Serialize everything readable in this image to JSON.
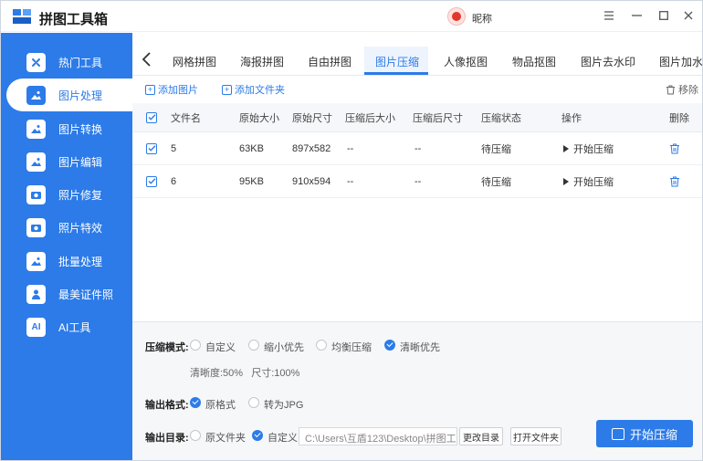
{
  "app": {
    "title": "拼图工具箱",
    "nickname": "昵称"
  },
  "sidebar": {
    "items": [
      {
        "label": "热门工具",
        "icon": "hot-tools-icon"
      },
      {
        "label": "图片处理",
        "icon": "image-process-icon",
        "active": true
      },
      {
        "label": "图片转换",
        "icon": "image-convert-icon"
      },
      {
        "label": "图片编辑",
        "icon": "image-edit-icon"
      },
      {
        "label": "照片修复",
        "icon": "photo-repair-icon"
      },
      {
        "label": "照片特效",
        "icon": "photo-effects-icon"
      },
      {
        "label": "批量处理",
        "icon": "batch-process-icon"
      },
      {
        "label": "最美证件照",
        "icon": "id-photo-icon"
      },
      {
        "label": "AI工具",
        "icon": "ai-tools-icon"
      }
    ]
  },
  "tabs": [
    "网格拼图",
    "海报拼图",
    "自由拼图",
    "图片压缩",
    "人像抠图",
    "物品抠图",
    "图片去水印",
    "图片加水"
  ],
  "toolbar": {
    "add_image": "添加图片",
    "add_folder": "添加文件夹",
    "remove": "移除"
  },
  "table": {
    "headers": [
      "文件名",
      "原始大小",
      "原始尺寸",
      "压缩后大小",
      "压缩后尺寸",
      "压缩状态",
      "操作",
      "删除"
    ],
    "rows": [
      {
        "name": "5",
        "size": "63KB",
        "dims": "897x582",
        "new_size": "--",
        "new_dims": "--",
        "status": "待压缩",
        "action": "开始压缩"
      },
      {
        "name": "6",
        "size": "95KB",
        "dims": "910x594",
        "new_size": "--",
        "new_dims": "--",
        "status": "待压缩",
        "action": "开始压缩"
      }
    ]
  },
  "settings": {
    "mode_label": "压缩模式:",
    "modes": [
      "自定义",
      "缩小优先",
      "均衡压缩",
      "清晰优先"
    ],
    "selected_mode": "清晰优先",
    "clarity_text": "清晰度:50%",
    "size_text": "尺寸:100%",
    "format_label": "输出格式:",
    "formats": [
      "原格式",
      "转为JPG"
    ],
    "selected_format": "原格式",
    "dir_label": "输出目录:",
    "dirs": [
      "原文件夹",
      "自定义"
    ],
    "selected_dir": "自定义",
    "path": "C:\\Users\\互盾123\\Desktop\\拼图工",
    "change_dir": "更改目录",
    "open_folder": "打开文件夹",
    "start": "开始压缩"
  },
  "colors": {
    "accent": "#2c7be8"
  }
}
